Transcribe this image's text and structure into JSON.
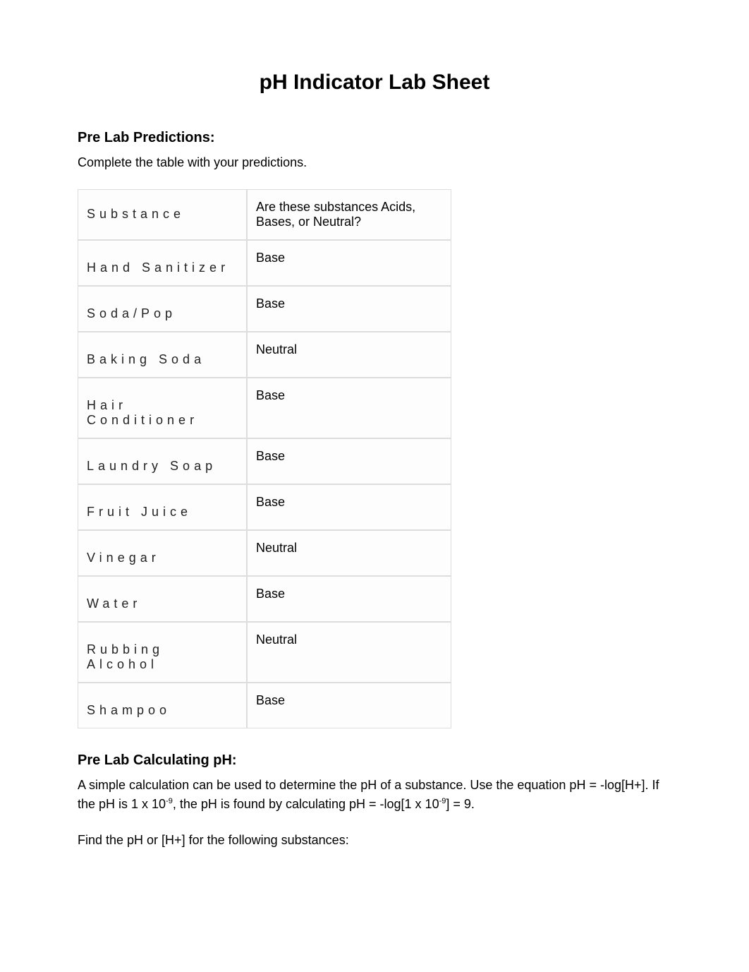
{
  "title": "pH Indicator Lab Sheet",
  "section1": {
    "heading": "Pre Lab Predictions:",
    "intro": "Complete the table with your predictions.",
    "table": {
      "header": {
        "c1": "Substance",
        "c2": "Are these substances Acids, Bases, or Neutral?"
      },
      "rows": [
        {
          "c1": "Hand Sanitizer",
          "c2": "Base"
        },
        {
          "c1": "Soda/Pop",
          "c2": "Base"
        },
        {
          "c1": "Baking Soda",
          "c2": "Neutral"
        },
        {
          "c1": "Hair Conditioner",
          "c2": "Base"
        },
        {
          "c1": "Laundry Soap",
          "c2": "Base"
        },
        {
          "c1": "Fruit Juice",
          "c2": "Base"
        },
        {
          "c1": "Vinegar",
          "c2": "Neutral"
        },
        {
          "c1": "Water",
          "c2": "Base"
        },
        {
          "c1": "Rubbing Alcohol",
          "c2": "Neutral"
        },
        {
          "c1": "Shampoo",
          "c2": "Base"
        }
      ]
    }
  },
  "section2": {
    "heading": "Pre Lab Calculating pH:",
    "para_parts": {
      "p1": "A simple calculation can be used to determine the pH of a substance. Use the equation pH = -log[H+]. If the pH is 1 x 10",
      "sup1": "-9",
      "p2": ", the pH is found by calculating pH = -log[1 x 10",
      "sup2": "-9",
      "p3": "] = 9."
    },
    "followup": "Find the pH or [H+] for the following substances:"
  }
}
